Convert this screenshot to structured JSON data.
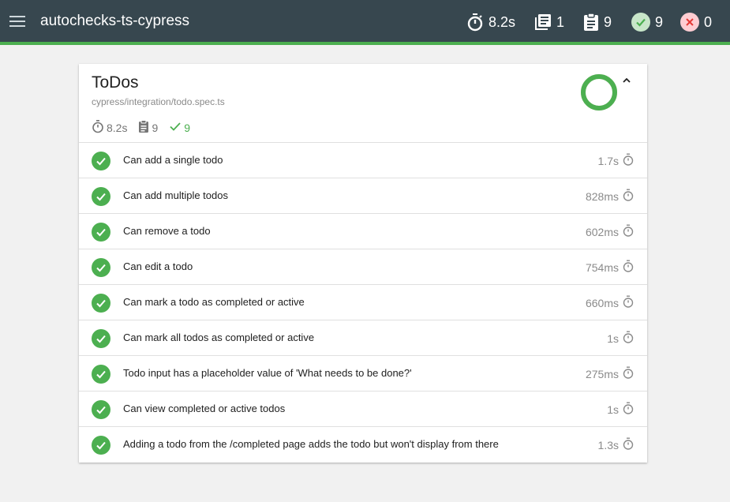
{
  "app": {
    "title": "autochecks-ts-cypress"
  },
  "summary": {
    "duration": "8.2s",
    "suites": "1",
    "tests": "9",
    "passes": "9",
    "failures": "0"
  },
  "suite": {
    "title": "ToDos",
    "file": "cypress/integration/todo.spec.ts",
    "duration": "8.2s",
    "tests": "9",
    "passes": "9",
    "pass_fraction": 1.0
  },
  "tests": [
    {
      "title": "Can add a single todo",
      "duration": "1.7s"
    },
    {
      "title": "Can add multiple todos",
      "duration": "828ms"
    },
    {
      "title": "Can remove a todo",
      "duration": "602ms"
    },
    {
      "title": "Can edit a todo",
      "duration": "754ms"
    },
    {
      "title": "Can mark a todo as completed or active",
      "duration": "660ms"
    },
    {
      "title": "Can mark all todos as completed or active",
      "duration": "1s"
    },
    {
      "title": "Todo input has a placeholder value of 'What needs to be done?'",
      "duration": "275ms"
    },
    {
      "title": "Can view completed or active todos",
      "duration": "1s"
    },
    {
      "title": "Adding a todo from the /completed page adds the todo but won't display from there",
      "duration": "1.3s"
    }
  ],
  "colors": {
    "topbar": "#37474f",
    "accent": "#4caf50",
    "failure": "#e53935"
  },
  "icons": {
    "menu": "menu-icon",
    "duration": "stopwatch-icon",
    "suites": "library-books-icon",
    "tests": "clipboard-icon",
    "passes": "check-circle-icon",
    "failures": "close-circle-icon",
    "collapse": "chevron-up-icon"
  }
}
